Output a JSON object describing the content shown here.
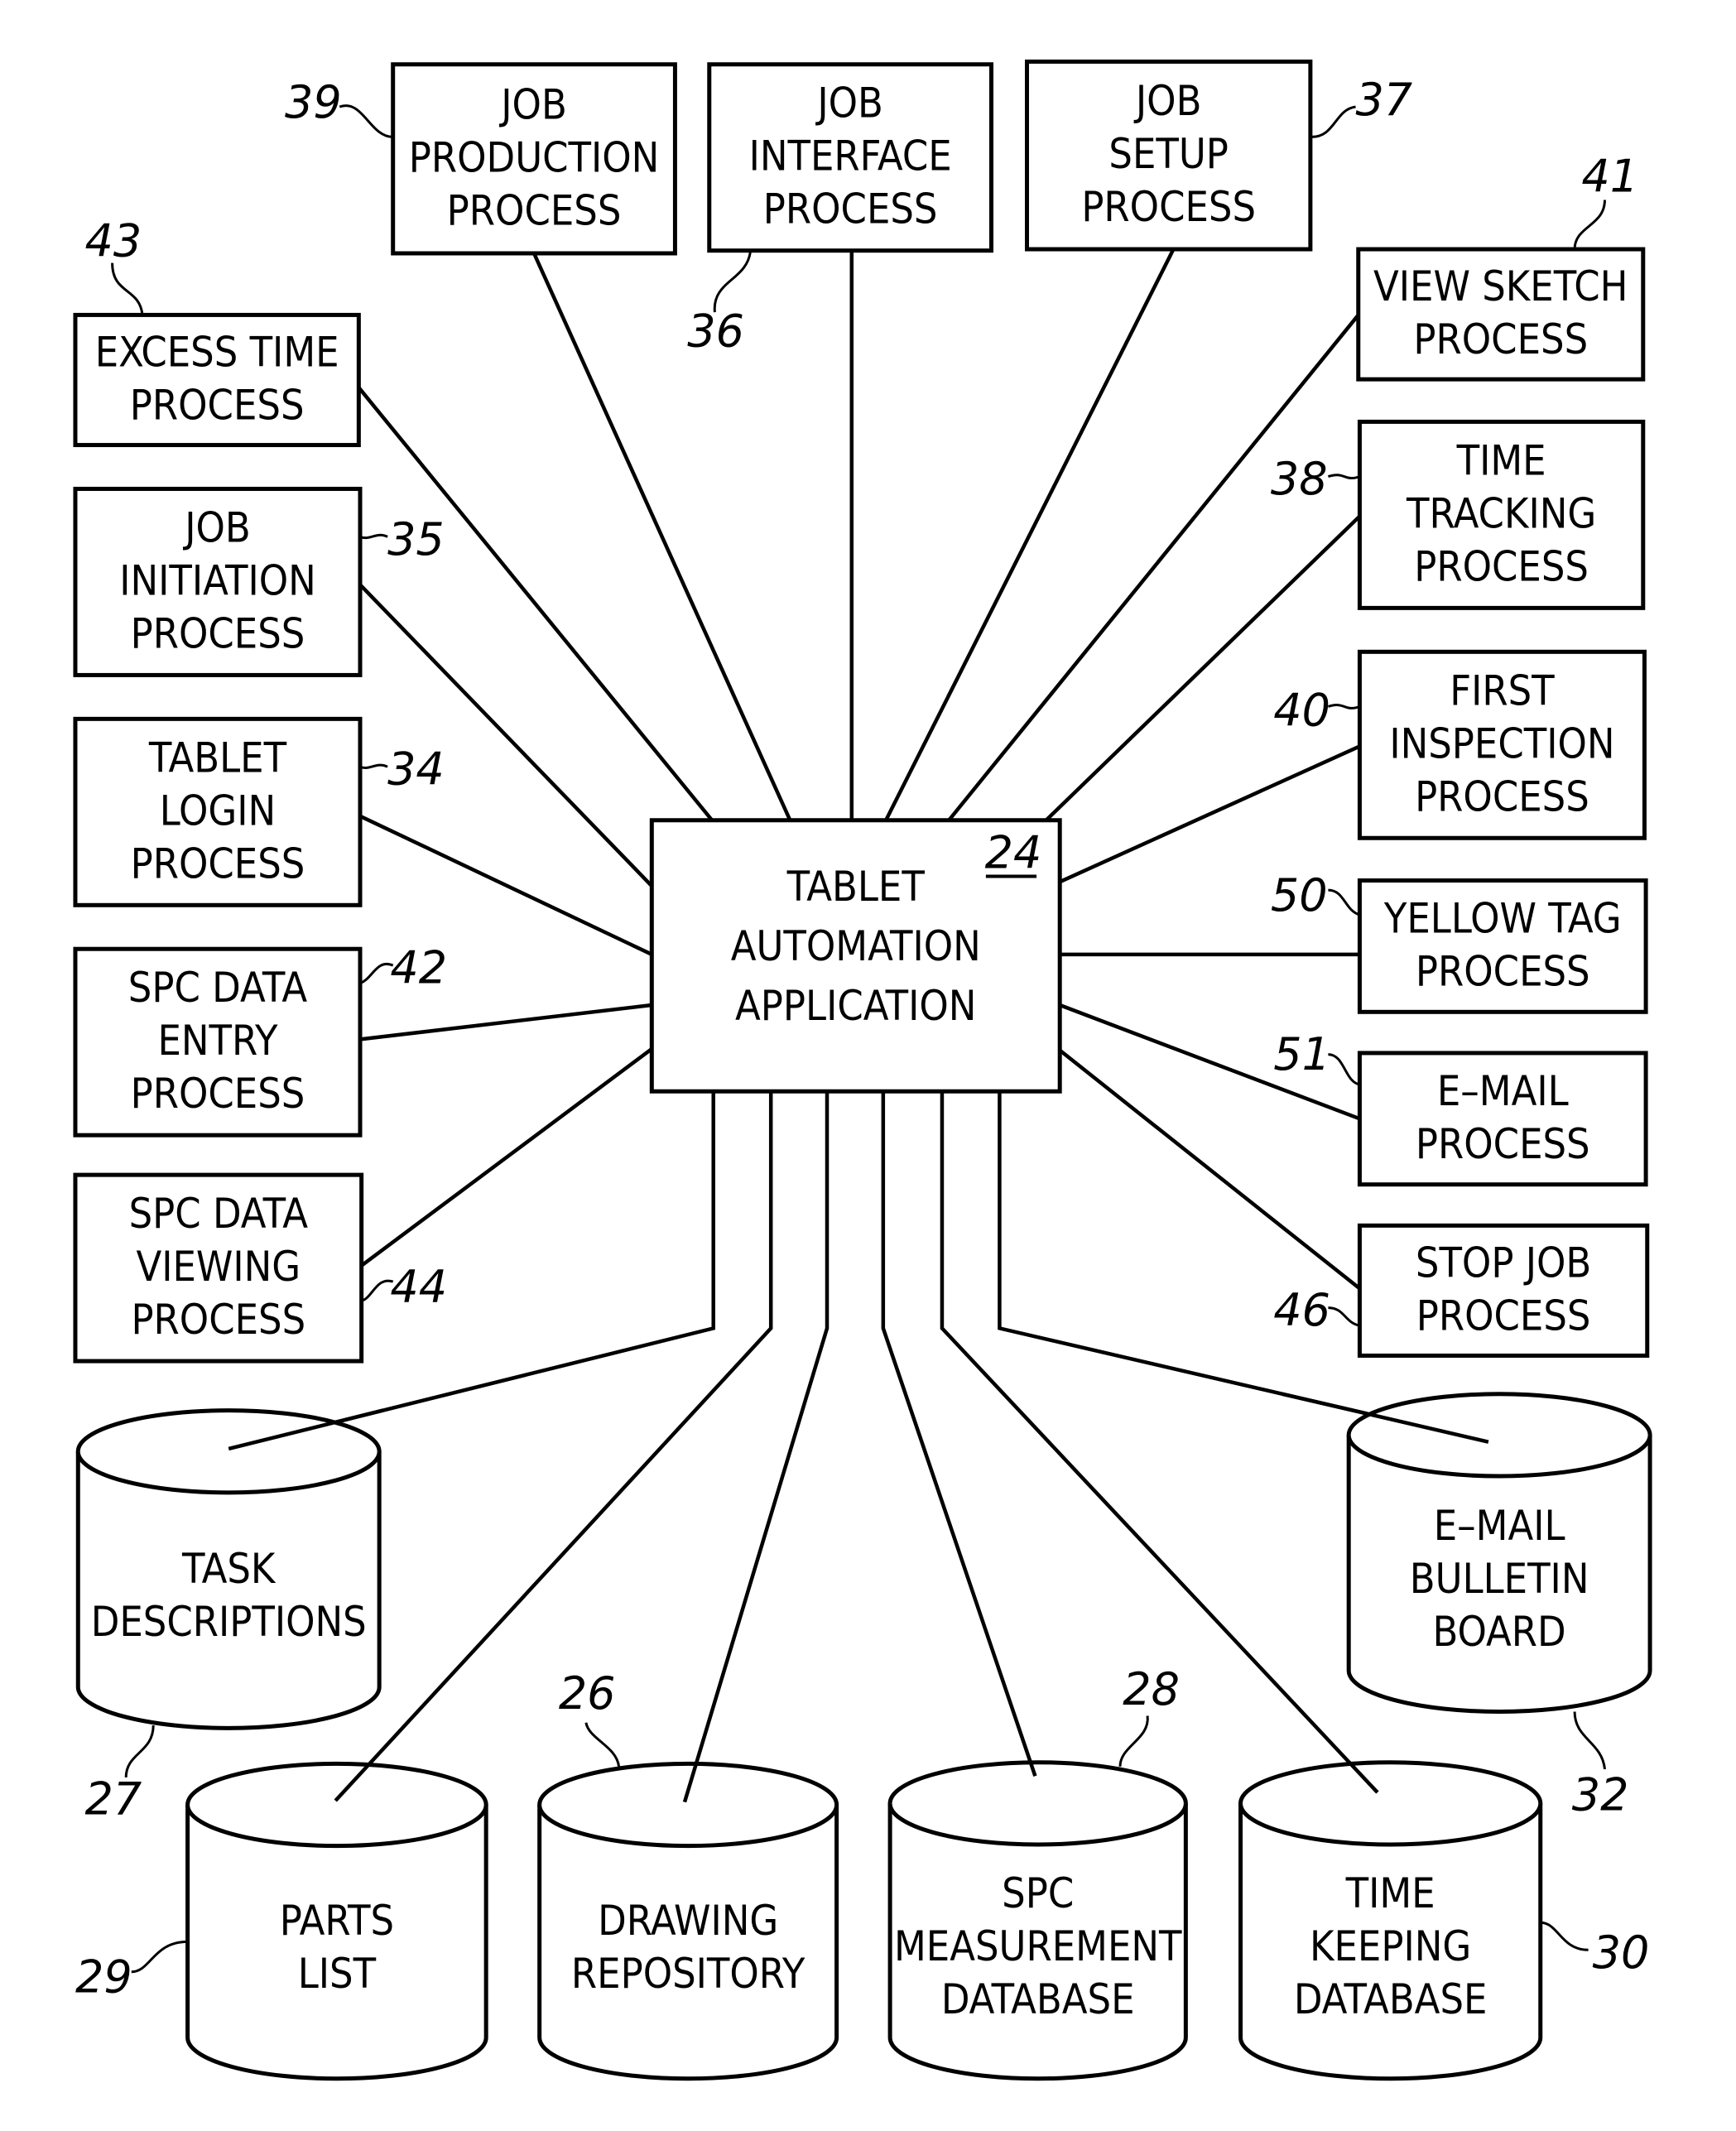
{
  "figure": {
    "center": {
      "ref": "24",
      "lines": [
        "TABLET",
        "AUTOMATION",
        "APPLICATION"
      ]
    },
    "processes": [
      {
        "id": "job-production-process",
        "ref": "39",
        "lines": [
          "JOB",
          "PRODUCTION",
          "PROCESS"
        ]
      },
      {
        "id": "job-interface-process",
        "ref": "36",
        "lines": [
          "JOB",
          "INTERFACE",
          "PROCESS"
        ]
      },
      {
        "id": "job-setup-process",
        "ref": "37",
        "lines": [
          "JOB",
          "SETUP",
          "PROCESS"
        ]
      },
      {
        "id": "view-sketch-process",
        "ref": "41",
        "lines": [
          "VIEW  SKETCH",
          "PROCESS"
        ]
      },
      {
        "id": "excess-time-process",
        "ref": "43",
        "lines": [
          "EXCESS  TIME",
          "PROCESS"
        ]
      },
      {
        "id": "job-initiation-process",
        "ref": "35",
        "lines": [
          "JOB",
          "INITIATION",
          "PROCESS"
        ]
      },
      {
        "id": "time-tracking-process",
        "ref": "38",
        "lines": [
          "TIME",
          "TRACKING",
          "PROCESS"
        ]
      },
      {
        "id": "tablet-login-process",
        "ref": "34",
        "lines": [
          "TABLET",
          "LOGIN",
          "PROCESS"
        ]
      },
      {
        "id": "first-inspection-process",
        "ref": "40",
        "lines": [
          "FIRST",
          "INSPECTION",
          "PROCESS"
        ]
      },
      {
        "id": "yellow-tag-process",
        "ref": "50",
        "lines": [
          "YELLOW  TAG",
          "PROCESS"
        ]
      },
      {
        "id": "spc-data-entry-process",
        "ref": "42",
        "lines": [
          "SPC  DATA",
          "ENTRY",
          "PROCESS"
        ]
      },
      {
        "id": "email-process",
        "ref": "51",
        "lines": [
          "E–MAIL",
          "PROCESS"
        ]
      },
      {
        "id": "spc-data-viewing-process",
        "ref": "44",
        "lines": [
          "SPC  DATA",
          "VIEWING",
          "PROCESS"
        ]
      },
      {
        "id": "stop-job-process",
        "ref": "46",
        "lines": [
          "STOP  JOB",
          "PROCESS"
        ]
      }
    ],
    "databases": [
      {
        "id": "task-descriptions",
        "ref": "27",
        "lines": [
          "TASK",
          "DESCRIPTIONS"
        ]
      },
      {
        "id": "email-bulletin-board",
        "ref": "32",
        "lines": [
          "E–MAIL",
          "BULLETIN",
          "BOARD"
        ]
      },
      {
        "id": "parts-list",
        "ref": "29",
        "lines": [
          "PARTS",
          "LIST"
        ]
      },
      {
        "id": "drawing-repository",
        "ref": "26",
        "lines": [
          "DRAWING",
          "REPOSITORY"
        ]
      },
      {
        "id": "spc-measurement-database",
        "ref": "28",
        "lines": [
          "SPC",
          "MEASUREMENT",
          "DATABASE"
        ]
      },
      {
        "id": "time-keeping-database",
        "ref": "30",
        "lines": [
          "TIME",
          "KEEPING",
          "DATABASE"
        ]
      }
    ]
  }
}
